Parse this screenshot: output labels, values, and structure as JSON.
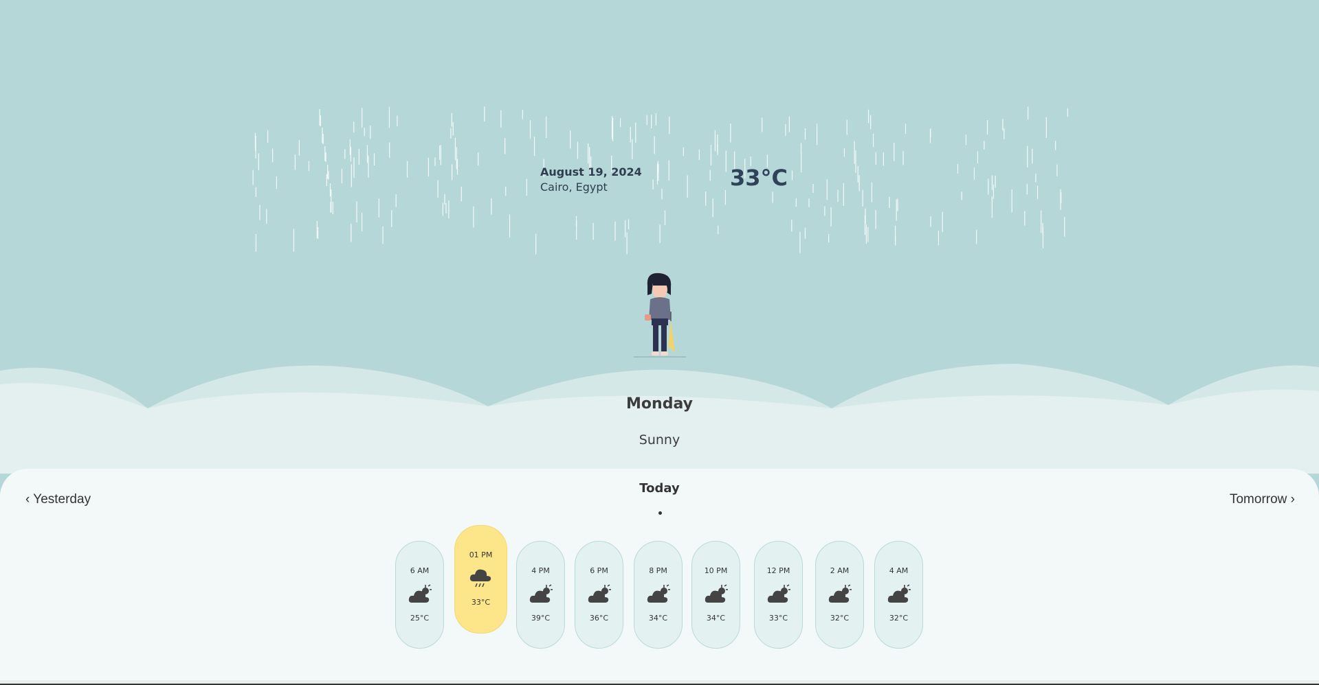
{
  "header": {
    "date": "August 19, 2024",
    "location": "Cairo, Egypt",
    "temperature": "33°C"
  },
  "day": {
    "name": "Monday",
    "condition": "Sunny"
  },
  "nav": {
    "prev": "‹ Yesterday",
    "current": "Today",
    "next": "Tomorrow ›"
  },
  "hourly": [
    {
      "time": "6 AM",
      "icon": "partly-cloudy-icon",
      "temp": "25°C",
      "active": false
    },
    {
      "time": "01 PM",
      "icon": "rain-cloud-icon",
      "temp": "33°C",
      "active": true
    },
    {
      "time": "4 PM",
      "icon": "partly-cloudy-icon",
      "temp": "39°C",
      "active": false
    },
    {
      "time": "6 PM",
      "icon": "partly-cloudy-icon",
      "temp": "36°C",
      "active": false
    },
    {
      "time": "8 PM",
      "icon": "partly-cloudy-icon",
      "temp": "34°C",
      "active": false
    },
    {
      "time": "10 PM",
      "icon": "partly-cloudy-icon",
      "temp": "34°C",
      "active": false
    },
    {
      "time": "12 PM",
      "icon": "partly-cloudy-icon",
      "temp": "33°C",
      "active": false
    },
    {
      "time": "2 AM",
      "icon": "partly-cloudy-icon",
      "temp": "32°C",
      "active": false
    },
    {
      "time": "4 AM",
      "icon": "partly-cloudy-icon",
      "temp": "32°C",
      "active": false
    }
  ],
  "colors": {
    "sky": "#b5d7d8",
    "highlight": "#fde58a",
    "card": "#e3f1f1"
  }
}
